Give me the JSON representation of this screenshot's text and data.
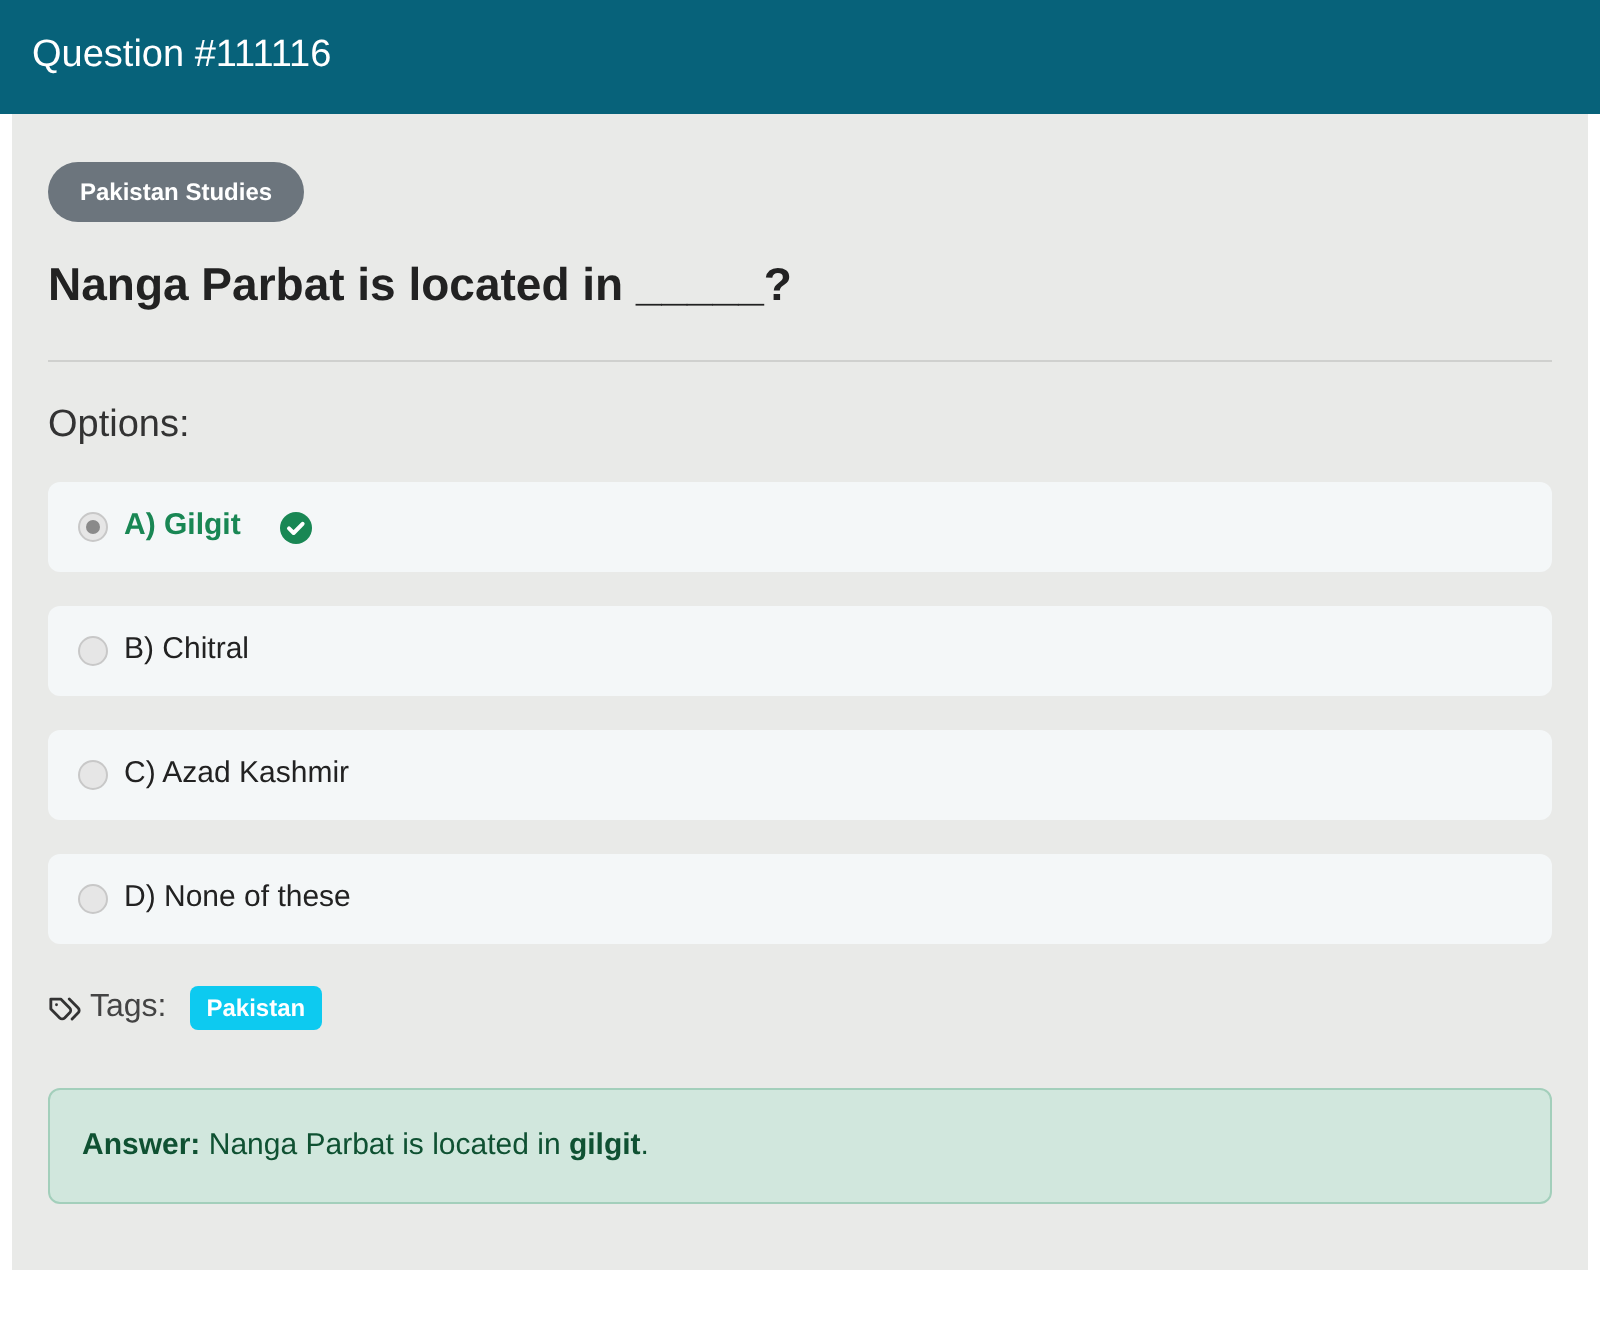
{
  "header": {
    "title": "Question #111116"
  },
  "category": "Pakistan Studies",
  "question": "Nanga Parbat is located in _____?",
  "options_label": "Options:",
  "options": [
    {
      "text": "A) Gilgit",
      "selected": true,
      "correct": true
    },
    {
      "text": "B) Chitral",
      "selected": false,
      "correct": false
    },
    {
      "text": "C) Azad Kashmir",
      "selected": false,
      "correct": false
    },
    {
      "text": "D) None of these",
      "selected": false,
      "correct": false
    }
  ],
  "tags_label": "Tags:",
  "tags": [
    "Pakistan"
  ],
  "answer": "**Answer:** Nanga Parbat is located in **gilgit**."
}
